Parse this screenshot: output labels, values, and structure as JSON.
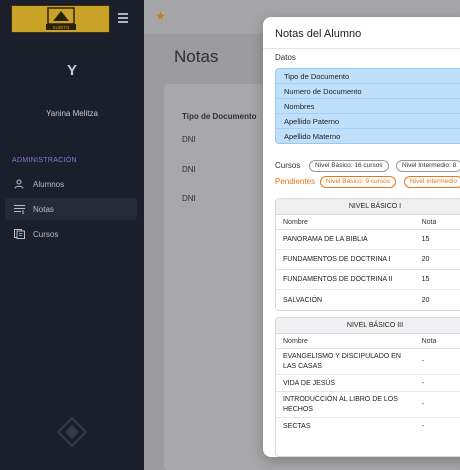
{
  "sidebar": {
    "logo_text": "SUBITO",
    "user_initial": "Y",
    "user_name": "Yanina Melitza",
    "section_label": "ADMINISTRACIÓN",
    "items": [
      {
        "label": "Alumnos",
        "icon": "user-icon",
        "active": false
      },
      {
        "label": "Notas",
        "icon": "list-icon",
        "active": true
      },
      {
        "label": "Cursos",
        "icon": "book-icon",
        "active": false
      }
    ]
  },
  "main": {
    "page_title": "Notas",
    "column_header": "Tipo de Documento",
    "rows": [
      "DNI",
      "DNI",
      "DNI"
    ]
  },
  "modal": {
    "title": "Notas del Alumno",
    "datos_label": "Datos",
    "datos_fields": [
      "Tipo de Documento",
      "Numero de Documento",
      "Nombres",
      "Apellido Paterno",
      "Apellido Materno"
    ],
    "cursos_label": "Cursos",
    "cursos_chips": [
      "Nivel Básico: 16 cursos",
      "Nivel Intermedio: 8"
    ],
    "pendientes_label": "Pendientes",
    "pendientes_chips": [
      "Nivel Básico: 9 cursos",
      "Nivel Intermedio"
    ],
    "table1": {
      "title": "NIVEL BÁSICO I",
      "col_name": "Nombre",
      "col_grade": "Nota",
      "rows": [
        {
          "name": "PANORAMA DE LA BIBLIA",
          "grade": "15"
        },
        {
          "name": "FUNDAMENTOS DE DOCTRINA I",
          "grade": "20"
        },
        {
          "name": "FUNDAMENTOS DE DOCTRINA II",
          "grade": "15"
        },
        {
          "name": "SALVACIÓN",
          "grade": "20"
        }
      ]
    },
    "table2": {
      "title": "NIVEL BÁSICO III",
      "col_name": "Nombre",
      "col_grade": "Nota",
      "rows": [
        {
          "name": "EVANGELISMO Y DISCIPULADO EN LAS CASAS",
          "grade": "-"
        },
        {
          "name": "VIDA DE JESÚS",
          "grade": "-"
        },
        {
          "name": "INTRODUCCIÓN AL LIBRO DE LOS HECHOS",
          "grade": "-"
        },
        {
          "name": "SECTAS",
          "grade": "-"
        }
      ]
    }
  },
  "colors": {
    "sidebar_bg": "#1b1e2b",
    "accent_purple": "#7d7fe0",
    "datos_bg": "#bfe0fb",
    "pending_orange": "#e8761a",
    "logo_gold": "#c9a227"
  }
}
